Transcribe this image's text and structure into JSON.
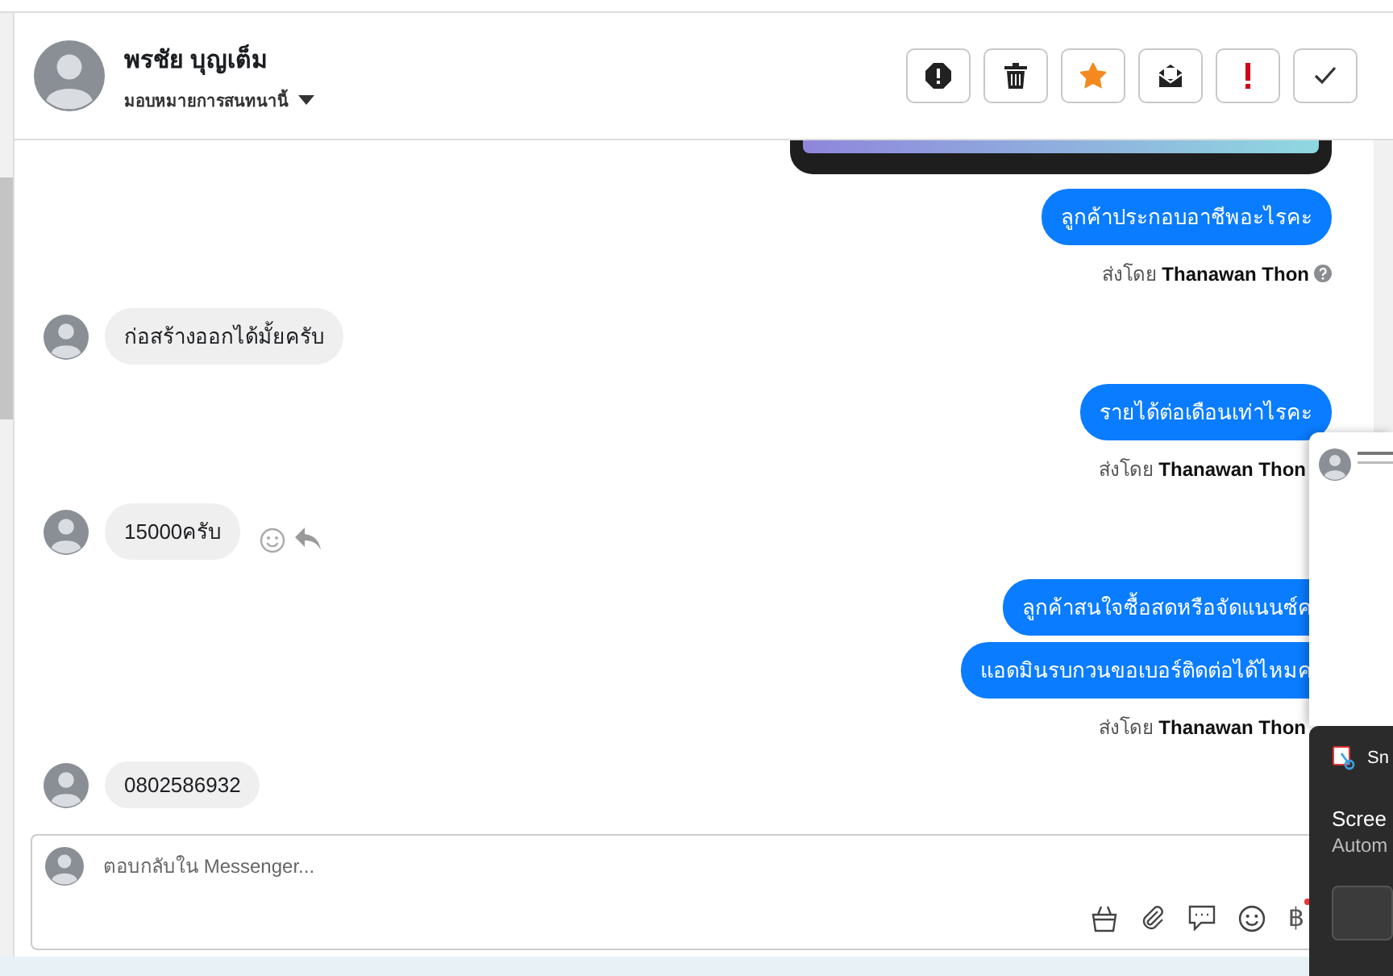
{
  "header": {
    "name": "พรชัย บุญเต็ม",
    "assign_label": "มอบหมายการสนทนานี้",
    "buttons": [
      {
        "kind": "spam"
      },
      {
        "kind": "delete"
      },
      {
        "kind": "star",
        "on": true
      },
      {
        "kind": "unread"
      },
      {
        "kind": "important"
      },
      {
        "kind": "done"
      }
    ]
  },
  "messages": [
    {
      "kind": "image"
    },
    {
      "kind": "outgoing",
      "text": "ลูกค้าประกอบอาชีพอะไรคะ",
      "clipped": false
    },
    {
      "kind": "sent_by",
      "text": "ส่งโดย **Thanawan Thon**",
      "help_icon": true
    },
    {
      "kind": "incoming",
      "text": "ก่อสร้างออกได้มั้ยครับ",
      "actions": false
    },
    {
      "kind": "outgoing",
      "text": "รายได้ต่อเดือนเท่าไรคะ",
      "clipped": false
    },
    {
      "kind": "sent_by",
      "text": "ส่งโดย **Thanawan Thon**",
      "help_icon": false
    },
    {
      "kind": "incoming",
      "text": "15000ครับ",
      "actions": true
    },
    {
      "kind": "outgoing",
      "text": "ลูกค้าสนใจซื้อสดหรือจัดแนนซ์ค",
      "clipped": true
    },
    {
      "kind": "outgoing",
      "text": "แอดมินรบกวนขอเบอร์ติดต่อได้ไหมค",
      "clipped": true
    },
    {
      "kind": "sent_by",
      "text": "ส่งโดย **Thanawan Thon**",
      "help_icon": false
    },
    {
      "kind": "incoming",
      "text": "0802586932",
      "actions": false
    }
  ],
  "composer": {
    "placeholder": "ตอบกลับใน Messenger...",
    "currency_symbol": "฿"
  },
  "notification": {
    "app": "Sn",
    "title": "Scree",
    "body": "Autom"
  }
}
